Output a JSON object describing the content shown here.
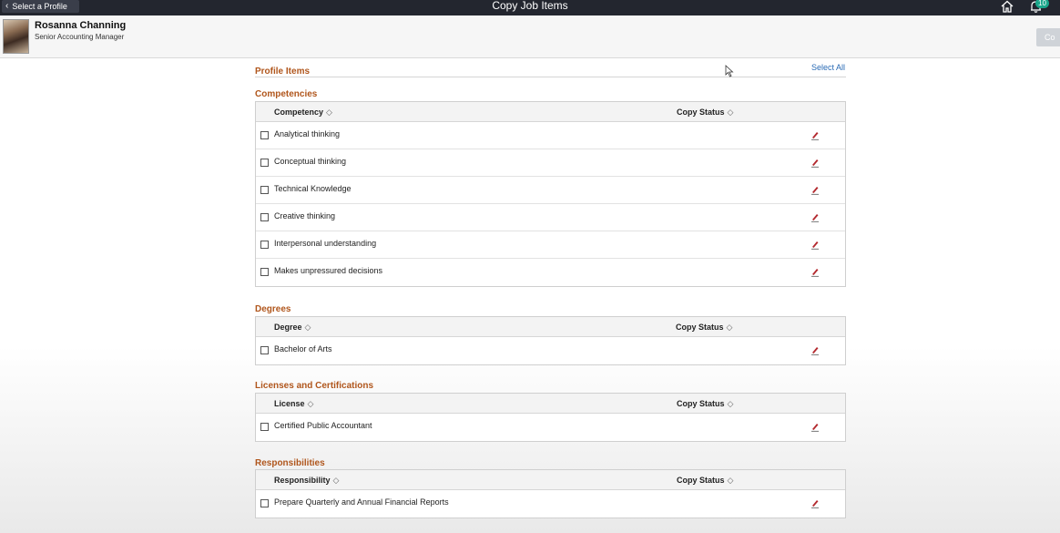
{
  "topbar": {
    "back_label": "Select a Profile",
    "title": "Copy Job Items",
    "notification_count": "10"
  },
  "profile": {
    "name": "Rosanna Channing",
    "role": "Senior Accounting Manager",
    "copy_button_label": "Co"
  },
  "profile_items": {
    "heading": "Profile Items",
    "select_all": "Select All"
  },
  "competencies": {
    "heading": "Competencies",
    "col1": "Competency",
    "col2": "Copy Status",
    "rows": [
      "Analytical thinking",
      "Conceptual thinking",
      "Technical Knowledge",
      "Creative thinking",
      "Interpersonal understanding",
      "Makes unpressured decisions"
    ]
  },
  "degrees": {
    "heading": "Degrees",
    "col1": "Degree",
    "col2": "Copy Status",
    "rows": [
      "Bachelor of Arts"
    ]
  },
  "licenses": {
    "heading": "Licenses and Certifications",
    "col1": "License",
    "col2": "Copy Status",
    "rows": [
      "Certified Public Accountant"
    ]
  },
  "responsibilities": {
    "heading": "Responsibilities",
    "col1": "Responsibility",
    "col2": "Copy Status",
    "rows": [
      "Prepare Quarterly and Annual Financial Reports"
    ]
  },
  "colors": {
    "topbar": "#23262f",
    "section_heading": "#b0561c",
    "link": "#2a6bb5",
    "badge": "#1aa68a"
  }
}
